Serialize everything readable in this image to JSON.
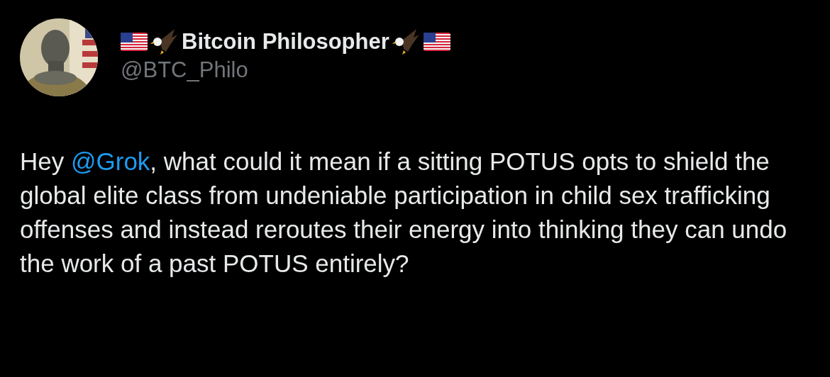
{
  "author": {
    "display_name": "Bitcoin Philosopher",
    "handle": "@BTC_Philo"
  },
  "tweet": {
    "text_before": "Hey ",
    "mention": "@Grok",
    "text_after": ", what could it mean if a sitting POTUS opts to shield the global elite class from undeniable participation in child sex trafficking offenses and instead reroutes their energy into thinking they can undo the work of a past POTUS entirely?"
  }
}
